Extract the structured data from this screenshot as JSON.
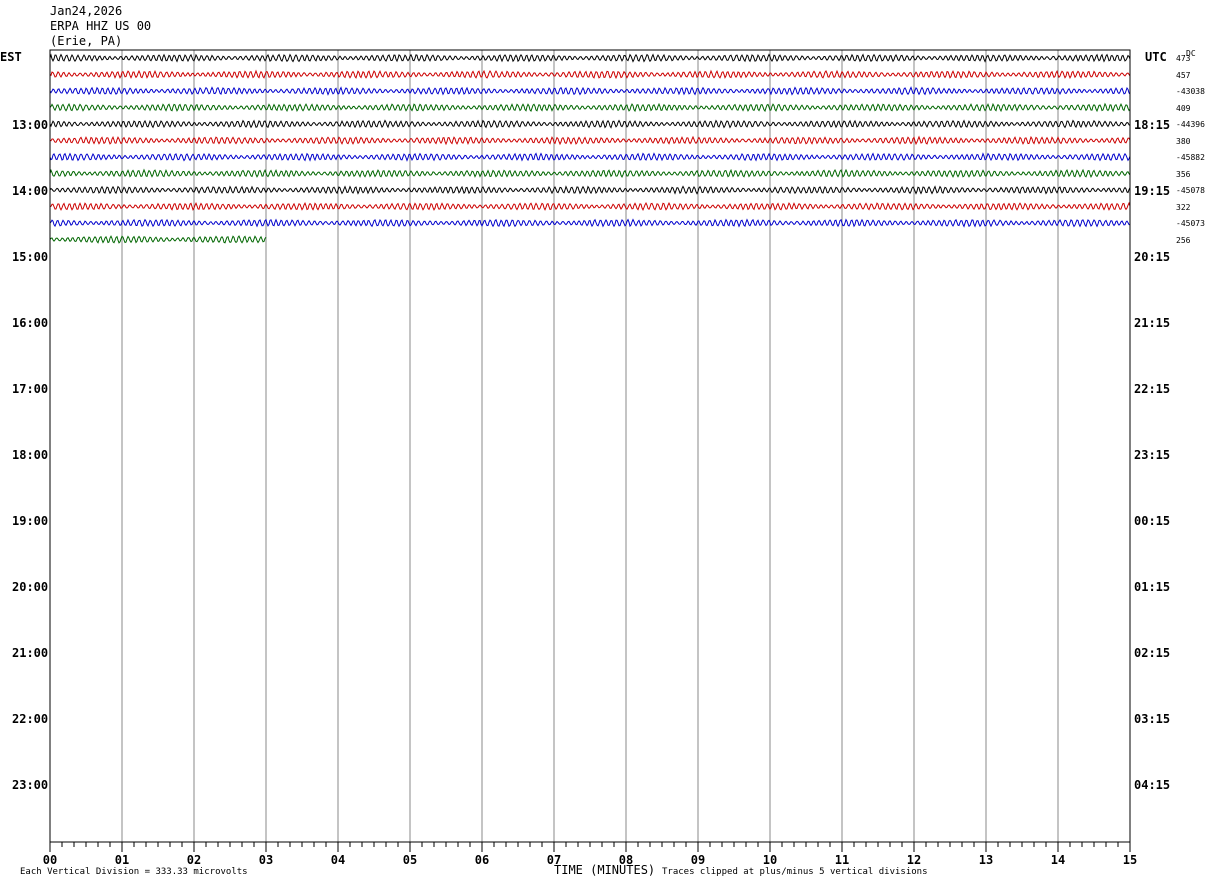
{
  "header": {
    "date": "Jan24,2026",
    "station": "ERPA HHZ US 00",
    "location": "(Erie, PA)"
  },
  "axes": {
    "left_timezone": "EST",
    "right_timezone": "UTC",
    "dc_label": "DC"
  },
  "footer": {
    "scale_note": "Each Vertical Division =  333.33 microvolts",
    "xlabel": "TIME (MINUTES)",
    "clip_note": "Traces clipped at plus/minus 5 vertical divisions"
  },
  "colors": {
    "black": "#000000",
    "red": "#cc0000",
    "blue": "#0000cc",
    "green": "#006600",
    "grid": "#888888"
  },
  "chart_data": {
    "type": "line",
    "x_ticks": [
      "00",
      "01",
      "02",
      "03",
      "04",
      "05",
      "06",
      "07",
      "08",
      "09",
      "10",
      "11",
      "12",
      "13",
      "14",
      "15"
    ],
    "xlim": [
      0,
      15
    ],
    "left_hour_labels": [
      "13:00",
      "14:00",
      "15:00",
      "16:00",
      "17:00",
      "18:00",
      "19:00",
      "20:00",
      "21:00",
      "22:00",
      "23:00"
    ],
    "right_hour_labels": [
      "18:15",
      "19:15",
      "20:15",
      "21:15",
      "22:15",
      "23:15",
      "00:15",
      "01:15",
      "02:15",
      "03:15",
      "04:15"
    ],
    "traces": [
      {
        "color": "black",
        "end_minute": 15,
        "dc": "473"
      },
      {
        "color": "red",
        "end_minute": 15,
        "dc": "457"
      },
      {
        "color": "blue",
        "end_minute": 15,
        "dc": "-43038"
      },
      {
        "color": "green",
        "end_minute": 15,
        "dc": "409"
      },
      {
        "color": "black",
        "end_minute": 15,
        "dc": "-44396"
      },
      {
        "color": "red",
        "end_minute": 15,
        "dc": "380"
      },
      {
        "color": "blue",
        "end_minute": 15,
        "dc": "-45882"
      },
      {
        "color": "green",
        "end_minute": 15,
        "dc": "356"
      },
      {
        "color": "black",
        "end_minute": 15,
        "dc": "-45078"
      },
      {
        "color": "red",
        "end_minute": 15,
        "dc": "322"
      },
      {
        "color": "blue",
        "end_minute": 15,
        "dc": "-45073"
      },
      {
        "color": "green",
        "end_minute": 3,
        "dc": "256"
      }
    ]
  }
}
